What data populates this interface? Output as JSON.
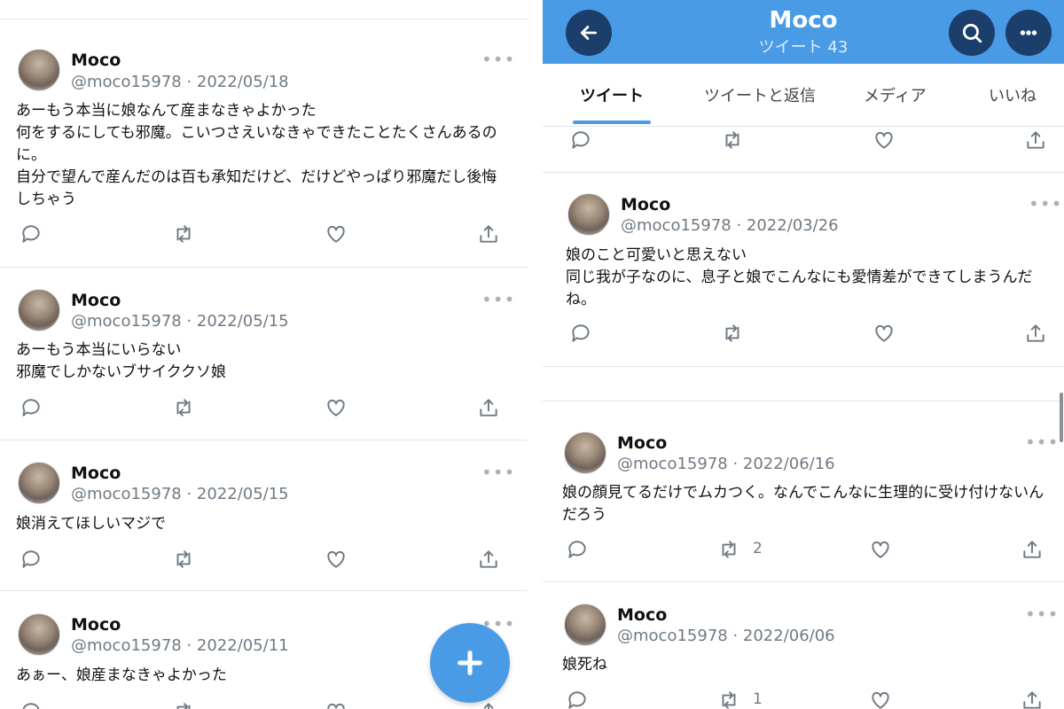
{
  "left": {
    "tweets": [
      {
        "name": "Moco",
        "meta": "@moco15978 · 2022/05/18",
        "text": "あーもう本当に娘なんて産まなきゃよかった\n何をするにしても邪魔。こいつさえいなきゃできたことたくさんあるのに。\n自分で望んで産んだのは百も承知だけど、だけどやっぱり邪魔だし後悔しちゃう"
      },
      {
        "name": "Moco",
        "meta": "@moco15978 · 2022/05/15",
        "text": "あーもう本当にいらない\n邪魔でしかないブサイククソ娘"
      },
      {
        "name": "Moco",
        "meta": "@moco15978 · 2022/05/15",
        "text": "娘消えてほしいマジで"
      },
      {
        "name": "Moco",
        "meta": "@moco15978 · 2022/05/11",
        "text": "あぁー、娘産まなきゃよかった"
      }
    ],
    "fab_icon": "plus-icon"
  },
  "right": {
    "header": {
      "title": "Moco",
      "subtitle": "ツイート 43"
    },
    "tabs": [
      "ツイート",
      "ツイートと返信",
      "メディア",
      "いいね"
    ],
    "tweets": [
      {
        "name": "Moco",
        "meta": "@moco15978 · 2022/03/26",
        "text": "娘のこと可愛いと思えない\n同じ我が子なのに、息子と娘でこんなにも愛情差ができてしまうんだね。",
        "retweets": ""
      },
      {
        "name": "Moco",
        "meta": "@moco15978 · 2022/06/16",
        "text": "娘の顔見てるだけでムカつく。なんでこんなに生理的に受け付けないんだろう",
        "retweets": "2"
      },
      {
        "name": "Moco",
        "meta": "@moco15978 · 2022/06/06",
        "text": "娘死ね",
        "retweets": "1"
      }
    ]
  },
  "colors": {
    "accent": "#4a9be6",
    "header_button": "#1c3e6b",
    "muted": "#6f7a84"
  }
}
